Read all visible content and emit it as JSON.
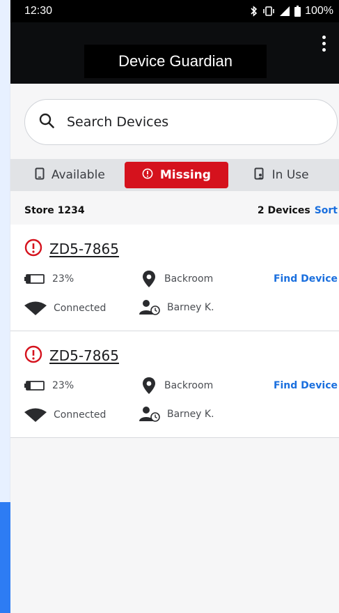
{
  "status_bar": {
    "time": "12:30",
    "battery_level": "100%",
    "icons": [
      "bluetooth-icon",
      "vibrate-icon",
      "signal-icon",
      "battery-icon"
    ]
  },
  "app_bar": {
    "title": "Device Guardian",
    "menu_icon": "overflow-menu-icon"
  },
  "search": {
    "placeholder": "Search Devices",
    "icon": "search-icon"
  },
  "tabs": [
    {
      "label": "Available",
      "icon": "phone-icon",
      "selected": false
    },
    {
      "label": "Missing",
      "icon": "alert-circle-icon",
      "selected": true
    },
    {
      "label": "In Use",
      "icon": "phone-user-icon",
      "selected": false
    }
  ],
  "list_header": {
    "store": "Store 1234",
    "device_count": "2 Devices",
    "sort_label": "Sort"
  },
  "devices": [
    {
      "name": "ZD5-7865",
      "battery": "23%",
      "location": "Backroom",
      "connection": "Connected",
      "user": "Barney K.",
      "action": "Find Device"
    },
    {
      "name": "ZD5-7865",
      "battery": "23%",
      "location": "Backroom",
      "connection": "Connected",
      "user": "Barney K.",
      "action": "Find Device"
    }
  ],
  "colors": {
    "accent_red": "#d5121d",
    "link_blue": "#1a6fde",
    "app_bar_bg": "#0c0d0f",
    "tab_bar_bg": "#e1e3e6"
  }
}
